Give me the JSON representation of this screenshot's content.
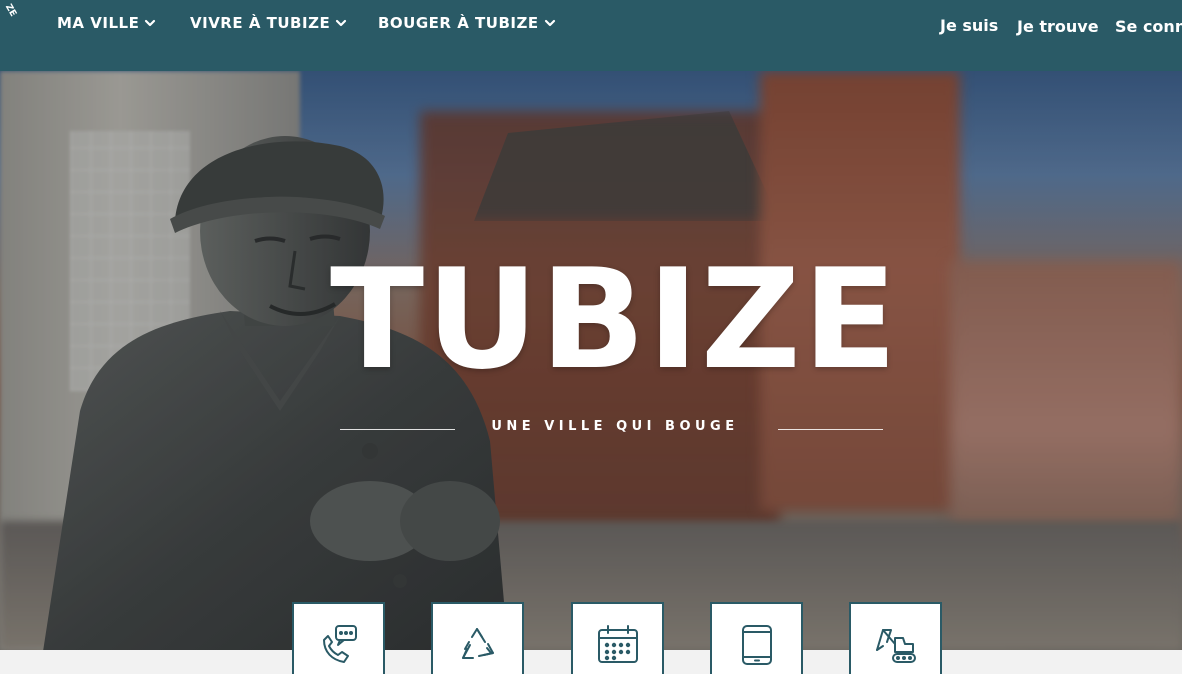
{
  "header": {
    "logo_fragment": "ZE",
    "nav": [
      {
        "label": "MA VILLE"
      },
      {
        "label": "VIVRE À TUBIZE"
      },
      {
        "label": "BOUGER À TUBIZE"
      }
    ],
    "top_links": [
      {
        "label": "Je suis"
      },
      {
        "label": "Je trouve"
      },
      {
        "label": "Se conn"
      }
    ]
  },
  "hero": {
    "title": "TUBIZE",
    "tagline": "UNE VILLE QUI BOUGE"
  },
  "quick_access": [
    {
      "icon": "phone-chat-icon"
    },
    {
      "icon": "recycle-icon"
    },
    {
      "icon": "calendar-icon"
    },
    {
      "icon": "tablet-icon"
    },
    {
      "icon": "excavator-icon"
    }
  ],
  "colors": {
    "header_bg": "#2a5a66",
    "tile_border": "#2a5a66",
    "icon_stroke": "#2a5a66",
    "text_on_dark": "#ffffff"
  }
}
